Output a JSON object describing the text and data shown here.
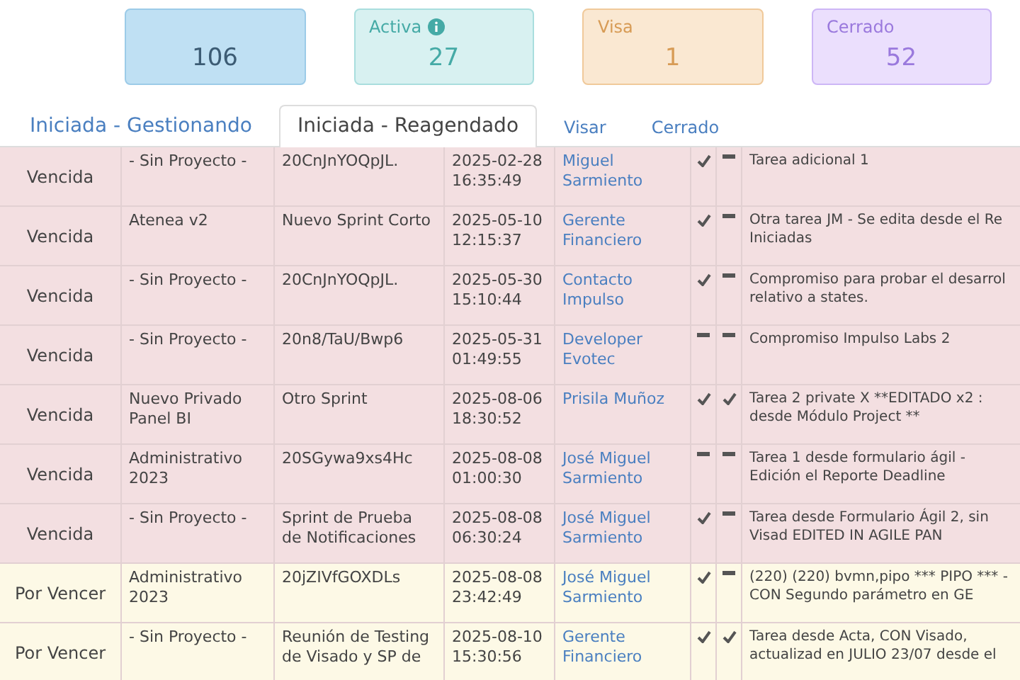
{
  "cards": [
    {
      "kind": "blue",
      "value": "106",
      "info": false
    },
    {
      "kind": "teal",
      "label": "Activa",
      "value": "27",
      "info": true
    },
    {
      "kind": "orange",
      "label": "Visa",
      "value": "1",
      "info": false
    },
    {
      "kind": "purple",
      "label": "Cerrado",
      "value": "52",
      "info": false
    }
  ],
  "tabs": [
    {
      "label": "Iniciada - Gestionando",
      "selected": false
    },
    {
      "label": "Iniciada - Reagendado",
      "selected": true
    },
    {
      "label": "Visar",
      "selected": false
    },
    {
      "label": "Cerrado",
      "selected": false
    }
  ],
  "rows": [
    {
      "kind": "vencida",
      "status": "Vencida",
      "project": "- Sin Proyecto -",
      "sprint": "20CnJnYOQpJL.",
      "datetime": "2025-02-28 16:35:49",
      "person": "Miguel Sarmiento",
      "check_a": true,
      "check_b": false,
      "description": "Tarea adicional 1"
    },
    {
      "kind": "vencida",
      "status": "Vencida",
      "project": "Atenea v2",
      "sprint": "Nuevo Sprint Corto",
      "datetime": "2025-05-10 12:15:37",
      "person": "Gerente Financiero",
      "check_a": true,
      "check_b": false,
      "description": "Otra tarea JM - Se edita desde el Re Iniciadas"
    },
    {
      "kind": "vencida",
      "status": "Vencida",
      "project": "- Sin Proyecto -",
      "sprint": "20CnJnYOQpJL.",
      "datetime": "2025-05-30 15:10:44",
      "person": "Contacto Impulso",
      "check_a": true,
      "check_b": false,
      "description": "Compromiso para probar el desarrol relativo a states."
    },
    {
      "kind": "vencida",
      "status": "Vencida",
      "project": "- Sin Proyecto -",
      "sprint": "20n8/TaU/Bwp6",
      "datetime": "2025-05-31 01:49:55",
      "person": "Developer Evotec",
      "check_a": false,
      "check_b": false,
      "description": "Compromiso Impulso Labs 2"
    },
    {
      "kind": "vencida",
      "status": "Vencida",
      "project": "Nuevo Privado Panel BI",
      "sprint": "Otro Sprint",
      "datetime": "2025-08-06 18:30:52",
      "person": "Prisila Muñoz",
      "check_a": true,
      "check_b": true,
      "description": "Tarea 2 private X **EDITADO x2 : desde Módulo Project **"
    },
    {
      "kind": "vencida",
      "status": "Vencida",
      "project": "Administrativo 2023",
      "sprint": "20SGywa9xs4Hc",
      "datetime": "2025-08-08 01:00:30",
      "person": "José Miguel Sarmiento",
      "check_a": false,
      "check_b": false,
      "description": "Tarea 1 desde formulario ágil - Edición el Reporte Deadline"
    },
    {
      "kind": "vencida",
      "status": "Vencida",
      "project": "- Sin Proyecto -",
      "sprint": "Sprint de Prueba de Notificaciones",
      "datetime": "2025-08-08 06:30:24",
      "person": "José Miguel Sarmiento",
      "check_a": true,
      "check_b": false,
      "description": "Tarea desde Formulario Ágil 2, sin Visad EDITED IN AGILE PAN"
    },
    {
      "kind": "por_vencer",
      "status": "Por Vencer",
      "project": "Administrativo 2023",
      "sprint": "20jZIVfGOXDLs",
      "datetime": "2025-08-08 23:42:49",
      "person": "José Miguel Sarmiento",
      "check_a": true,
      "check_b": false,
      "description": "(220) (220) bvmn,pipo *** PIPO *** - CON Segundo parámetro en GE"
    },
    {
      "kind": "por_vencer",
      "status": "Por Vencer",
      "project": "- Sin Proyecto -",
      "sprint": "Reunión de Testing de Visado y SP de",
      "datetime": "2025-08-10 15:30:56",
      "person": "Gerente Financiero",
      "check_a": true,
      "check_b": true,
      "description": "Tarea desde Acta, CON Visado, actualizad en JULIO 23/07 desde el"
    }
  ]
}
